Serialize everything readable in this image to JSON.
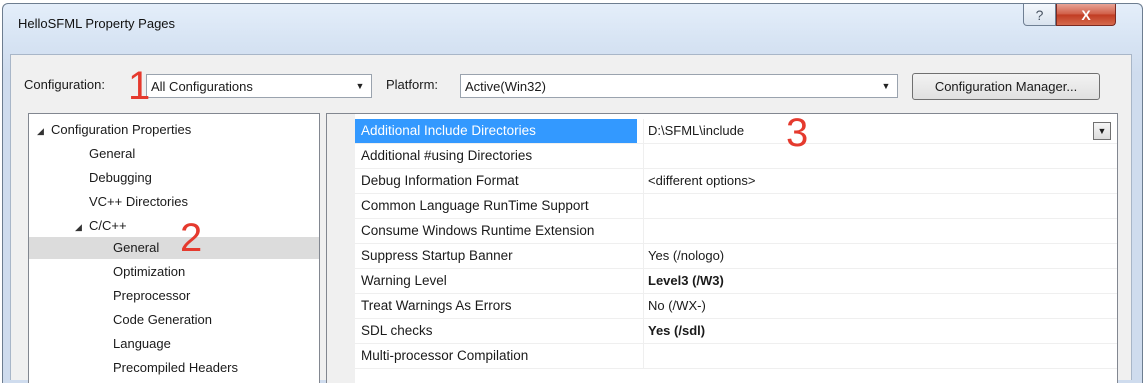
{
  "window": {
    "title": "HelloSFML Property Pages",
    "help_label": "?",
    "close_label": "X"
  },
  "toolbar": {
    "configuration_label": "Configuration:",
    "configuration_value": "All Configurations",
    "platform_label": "Platform:",
    "platform_value": "Active(Win32)",
    "config_manager_label": "Configuration Manager...",
    "dropdown_glyph": "▼"
  },
  "tree": {
    "expand_glyph": "◢",
    "items": [
      {
        "label": "Configuration Properties"
      },
      {
        "label": "General"
      },
      {
        "label": "Debugging"
      },
      {
        "label": "VC++ Directories"
      },
      {
        "label": "C/C++"
      },
      {
        "label": "General"
      },
      {
        "label": "Optimization"
      },
      {
        "label": "Preprocessor"
      },
      {
        "label": "Code Generation"
      },
      {
        "label": "Language"
      },
      {
        "label": "Precompiled Headers"
      }
    ]
  },
  "grid": {
    "rows": [
      {
        "name": "Additional Include Directories",
        "value": "D:\\SFML\\include"
      },
      {
        "name": "Additional #using Directories",
        "value": ""
      },
      {
        "name": "Debug Information Format",
        "value": "<different options>"
      },
      {
        "name": "Common Language RunTime Support",
        "value": ""
      },
      {
        "name": "Consume Windows Runtime Extension",
        "value": ""
      },
      {
        "name": "Suppress Startup Banner",
        "value": "Yes (/nologo)"
      },
      {
        "name": "Warning Level",
        "value": "Level3 (/W3)"
      },
      {
        "name": "Treat Warnings As Errors",
        "value": "No (/WX-)"
      },
      {
        "name": "SDL checks",
        "value": "Yes (/sdl)"
      },
      {
        "name": "Multi-processor Compilation",
        "value": ""
      }
    ]
  },
  "annotations": {
    "marker_1": "1",
    "marker_2": "2",
    "marker_3": "3"
  },
  "colors": {
    "selection": "#3399ff",
    "marker": "#e53a2e"
  }
}
